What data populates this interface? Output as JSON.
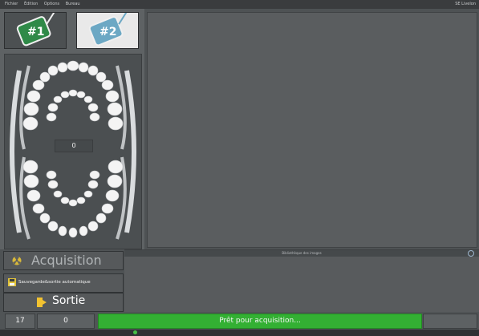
{
  "menu": {
    "items": [
      "Fichier",
      "Édition",
      "Options",
      "Bureau"
    ],
    "right_text": "SE Livelon"
  },
  "sensors": {
    "sensor1_label": "#1",
    "sensor2_label": "#2"
  },
  "tooth_chart": {
    "count": "0"
  },
  "library": {
    "title": "Bibliothèque des images"
  },
  "buttons": {
    "acquisition": "Acquisition",
    "auto_save": "Sauvegarde&sortie automatique",
    "exit": "Sortie"
  },
  "status": {
    "field1": "17",
    "field2": "0",
    "message": "Prêt pour acquisition...",
    "message_color": "#33b033"
  }
}
